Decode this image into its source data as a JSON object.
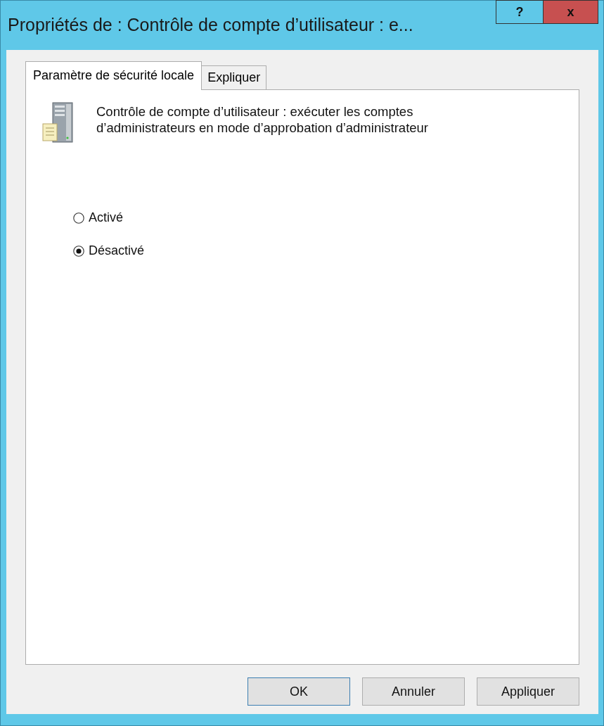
{
  "window": {
    "title": "Propriétés de : Contrôle de compte d’utilisateur : e..."
  },
  "title_buttons": [
    {
      "kind": "help",
      "label": "?"
    },
    {
      "kind": "close",
      "label": "x"
    }
  ],
  "tabs": [
    {
      "label": "Paramètre de sécurité locale",
      "selected": true
    },
    {
      "label": "Expliquer",
      "selected": false
    }
  ],
  "policy": {
    "description": "Contrôle de compte d’utilisateur : exécuter les comptes d’administrateurs en mode d’approbation d’administrateur"
  },
  "options": [
    {
      "label": "Activé",
      "selected": false
    },
    {
      "label": "Désactivé",
      "selected": true
    }
  ],
  "buttons": [
    {
      "label": "OK",
      "default": true
    },
    {
      "label": "Annuler",
      "default": false
    },
    {
      "label": "Appliquer",
      "default": false
    }
  ]
}
